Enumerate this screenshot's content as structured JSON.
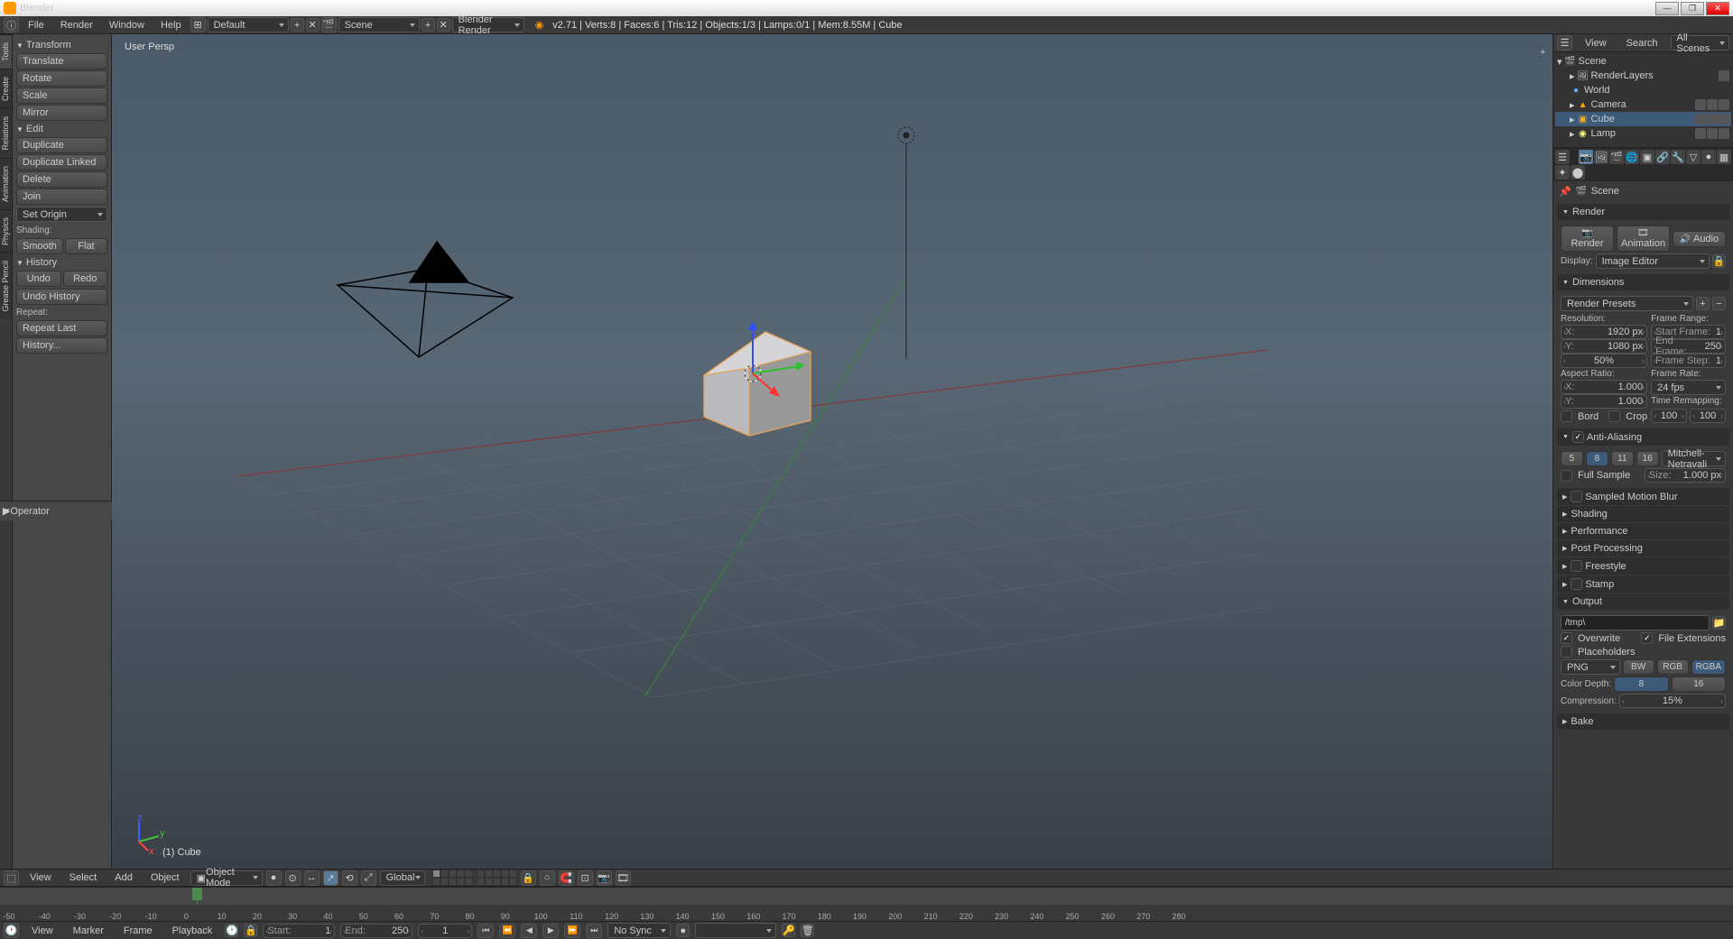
{
  "app_title": "Blender",
  "top_menu": [
    "File",
    "Render",
    "Window",
    "Help"
  ],
  "layout_dropdown": "Default",
  "scene_dropdown": "Scene",
  "renderer_dropdown": "Blender Render",
  "stats": "v2.71 | Verts:8 | Faces:6 | Tris:12 | Objects:1/3 | Lamps:0/1 | Mem:8.55M | Cube",
  "side_tabs": [
    "Tools",
    "Create",
    "Relations",
    "Animation",
    "Physics",
    "Grease Pencil"
  ],
  "tool_panel": {
    "transform_header": "Transform",
    "translate": "Translate",
    "rotate": "Rotate",
    "scale": "Scale",
    "mirror": "Mirror",
    "edit_header": "Edit",
    "duplicate": "Duplicate",
    "duplicate_linked": "Duplicate Linked",
    "delete": "Delete",
    "join": "Join",
    "set_origin": "Set Origin",
    "shading_label": "Shading:",
    "smooth": "Smooth",
    "flat": "Flat",
    "history_header": "History",
    "undo": "Undo",
    "redo": "Redo",
    "undo_history": "Undo History",
    "repeat_label": "Repeat:",
    "repeat_last": "Repeat Last",
    "history_btn": "History..."
  },
  "operator_label": "Operator",
  "viewport": {
    "persp": "User Persp",
    "obj": "(1) Cube"
  },
  "outliner": {
    "header": {
      "view": "View",
      "search": "Search",
      "all_scenes": "All Scenes"
    },
    "tree": {
      "scene": "Scene",
      "render_layers": "RenderLayers",
      "world": "World",
      "camera": "Camera",
      "cube": "Cube",
      "lamp": "Lamp"
    }
  },
  "props": {
    "breadcrumb": "Scene",
    "render_header": "Render",
    "render_btn": "Render",
    "animation_btn": "Animation",
    "audio_btn": "Audio",
    "display_label": "Display:",
    "display_value": "Image Editor",
    "dimensions_header": "Dimensions",
    "render_presets": "Render Presets",
    "resolution_label": "Resolution:",
    "frame_range_label": "Frame Range:",
    "res_x": "X:",
    "res_x_val": "1920 px",
    "res_y": "Y:",
    "res_y_val": "1080 px",
    "res_pct": "50%",
    "start_frame": "Start Frame:",
    "start_frame_val": "1",
    "end_frame": "End Frame:",
    "end_frame_val": "250",
    "frame_step": "Frame Step:",
    "frame_step_val": "1",
    "aspect_label": "Aspect Ratio:",
    "frame_rate_label": "Frame Rate:",
    "asp_x": "X:",
    "asp_x_val": "1.000",
    "asp_y": "Y:",
    "asp_y_val": "1.000",
    "fps": "24 fps",
    "time_remap": "Time Remapping:",
    "remap_old": "100",
    "remap_new": "100",
    "border": "Bord",
    "crop": "Crop",
    "aa_header": "Anti-Aliasing",
    "aa_samples": [
      "5",
      "8",
      "11",
      "16"
    ],
    "aa_filter": "Mitchell-Netravali",
    "full_sample": "Full Sample",
    "aa_size": "Size:",
    "aa_size_val": "1.000 px",
    "motion_blur": "Sampled Motion Blur",
    "shading": "Shading",
    "performance": "Performance",
    "post_processing": "Post Processing",
    "freestyle": "Freestyle",
    "stamp": "Stamp",
    "output_header": "Output",
    "output_path": "/tmp\\",
    "overwrite": "Overwrite",
    "file_ext": "File Extensions",
    "placeholders": "Placeholders",
    "format": "PNG",
    "bw": "BW",
    "rgb": "RGB",
    "rgba": "RGBA",
    "color_depth": "Color Depth:",
    "depth_8": "8",
    "depth_16": "16",
    "compression": "Compression:",
    "compression_val": "15%",
    "bake": "Bake"
  },
  "view3d_header": {
    "view": "View",
    "select": "Select",
    "add": "Add",
    "object": "Object",
    "mode": "Object Mode",
    "orientation": "Global"
  },
  "timeline": {
    "view": "View",
    "marker": "Marker",
    "frame": "Frame",
    "playback": "Playback",
    "start_label": "Start:",
    "start_val": "1",
    "end_label": "End:",
    "end_val": "250",
    "current": "1",
    "sync": "No Sync",
    "ticks": [
      -50,
      -40,
      -30,
      -20,
      -10,
      0,
      10,
      20,
      30,
      40,
      50,
      60,
      70,
      80,
      90,
      100,
      110,
      120,
      130,
      140,
      150,
      160,
      170,
      180,
      190,
      200,
      210,
      220,
      230,
      240,
      250,
      260,
      270,
      280
    ]
  }
}
